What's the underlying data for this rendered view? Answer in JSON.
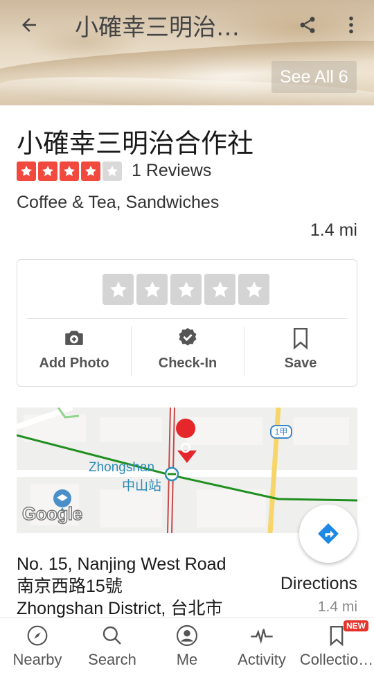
{
  "header": {
    "title": "小確幸三明治…",
    "see_all_label": "See All 6"
  },
  "business": {
    "name": "小確幸三明治合作社",
    "rating": 4,
    "rating_max": 5,
    "reviews_label": "1 Reviews",
    "categories": "Coffee & Tea, Sandwiches",
    "distance": "1.4 mi"
  },
  "actions": {
    "add_photo": "Add Photo",
    "check_in": "Check-In",
    "save": "Save"
  },
  "map": {
    "station_en": "Zhongshan",
    "station_zh": "中山站",
    "route_badge": "1甲",
    "attribution": "Google"
  },
  "address": {
    "line1": "No. 15, Nanjing West Road",
    "line2": "南京西路15號",
    "line3": "Zhongshan District, 台北市"
  },
  "directions": {
    "label": "Directions",
    "distance": "1.4 mi"
  },
  "nav": {
    "nearby": "Nearby",
    "search": "Search",
    "me": "Me",
    "activity": "Activity",
    "collections": "Collectio…",
    "new_badge": "NEW"
  },
  "colors": {
    "brand_red": "#f1493d",
    "link_blue": "#2d8bb7",
    "nav_green": "#29a329"
  }
}
